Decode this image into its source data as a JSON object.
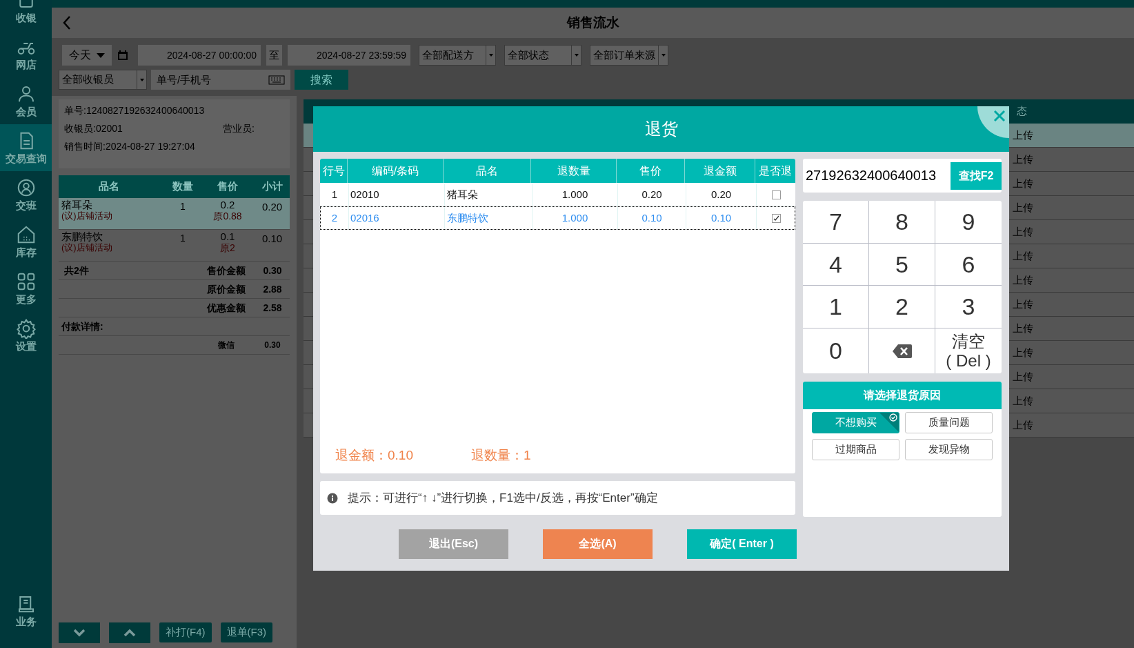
{
  "sidebar": {
    "items": [
      {
        "label": "收银",
        "selected": false
      },
      {
        "label": "网店",
        "selected": false
      },
      {
        "label": "会员",
        "selected": false
      },
      {
        "label": "交易查询",
        "selected": true
      },
      {
        "label": "交班",
        "selected": false
      },
      {
        "label": "库存",
        "selected": false
      },
      {
        "label": "更多",
        "selected": false
      },
      {
        "label": "设置",
        "selected": false
      }
    ],
    "bottom_items": [
      {
        "label": "业务",
        "selected": false
      }
    ]
  },
  "header": {
    "title": "销售流水"
  },
  "filters": {
    "period": "今天",
    "date_from": "2024-08-27 00:00:00",
    "range_separator": "至",
    "date_to": "2024-08-27 23:59:59",
    "dropdowns": [
      "全部配送方",
      "全部状态",
      "全部订单来源"
    ],
    "cashier": "全部收银员",
    "search_placeholder": "单号/手机号",
    "search_button": "搜索"
  },
  "order": {
    "number": "单号:1240827192632400640013",
    "cashier": "收银员:02001",
    "salesperson": "营业员:",
    "time": "销售时间:2024-08-27 19:27:04",
    "columns": [
      "品名",
      "数量",
      "售价",
      "小计"
    ],
    "rows": [
      {
        "name": "猪耳朵",
        "promo": "(议)店铺活动",
        "qty": "1",
        "price": "0.2",
        "original": "原0.88",
        "subtotal": "0.20",
        "selected": true
      },
      {
        "name": "东鹏特饮",
        "promo": "(议)店铺活动",
        "qty": "1",
        "price": "0.1",
        "original": "原2",
        "subtotal": "0.10",
        "selected": false
      }
    ],
    "count": "共2件",
    "totals": [
      {
        "label": "售价金额",
        "value": "0.30"
      },
      {
        "label": "原价金额",
        "value": "2.88"
      },
      {
        "label": "优惠金额",
        "value": "2.58"
      }
    ],
    "payment_title": "付款详情:",
    "payments": [
      {
        "method": "微信",
        "amount": "0.30"
      }
    ],
    "buttons": [
      {
        "kind": "down"
      },
      {
        "kind": "up"
      },
      {
        "kind": "text",
        "label": "补打(F4)"
      },
      {
        "kind": "text",
        "label": "退单(F3)"
      }
    ]
  },
  "list": {
    "column": "态",
    "rows": [
      {
        "status": "上传",
        "selected": true
      },
      {
        "status": "上传",
        "selected": false
      },
      {
        "status": "上传",
        "selected": false
      },
      {
        "status": "上传",
        "selected": false
      },
      {
        "status": "上传",
        "selected": false
      },
      {
        "status": "上传",
        "selected": false
      },
      {
        "status": "上传",
        "selected": false
      },
      {
        "status": "上传",
        "selected": false
      },
      {
        "status": "上传",
        "selected": false
      },
      {
        "status": "上传",
        "selected": false
      },
      {
        "status": "上传",
        "selected": false
      },
      {
        "status": "上传",
        "selected": false
      },
      {
        "status": "上传",
        "selected": false
      }
    ]
  },
  "dialog": {
    "title": "退货",
    "columns": [
      "行号",
      "编码/条码",
      "品名",
      "退数量",
      "售价",
      "退金额",
      "是否退"
    ],
    "rows": [
      {
        "line": "1",
        "code": "02010",
        "name": "猪耳朵",
        "qty": "1.000",
        "price": "0.20",
        "amount": "0.20",
        "checked": false,
        "selected": false
      },
      {
        "line": "2",
        "code": "02016",
        "name": "东鹏特饮",
        "qty": "1.000",
        "price": "0.10",
        "amount": "0.10",
        "checked": true,
        "selected": true
      }
    ],
    "summary": [
      "退金额：0.10",
      "退数量：1"
    ],
    "hint": "提示：可进行“↑ ↓”进行切换，F1选中/反选，再按“Enter”确定",
    "lookup": {
      "value": "27192632400640013",
      "button": "查找F2"
    },
    "keypad": [
      {
        "kind": "key",
        "label": "7"
      },
      {
        "kind": "key",
        "label": "8"
      },
      {
        "kind": "key",
        "label": "9"
      },
      {
        "kind": "key",
        "label": "4"
      },
      {
        "kind": "key",
        "label": "5"
      },
      {
        "kind": "key",
        "label": "6"
      },
      {
        "kind": "key",
        "label": "1"
      },
      {
        "kind": "key",
        "label": "2"
      },
      {
        "kind": "key",
        "label": "3"
      },
      {
        "kind": "key",
        "label": "0"
      },
      {
        "kind": "backspace"
      },
      {
        "kind": "clear",
        "label": "清空",
        "sublabel": "( Del )"
      }
    ],
    "reasons": {
      "title": "请选择退货原因",
      "options": [
        {
          "label": "不想购买",
          "selected": true
        },
        {
          "label": "质量问题",
          "selected": false
        },
        {
          "label": "过期商品",
          "selected": false
        },
        {
          "label": "发现异物",
          "selected": false
        }
      ]
    },
    "buttons": [
      {
        "kind": "exit",
        "label": "退出(Esc)"
      },
      {
        "kind": "select_all",
        "label": "全选(A)"
      },
      {
        "kind": "confirm",
        "label": "确定( Enter )"
      }
    ]
  }
}
